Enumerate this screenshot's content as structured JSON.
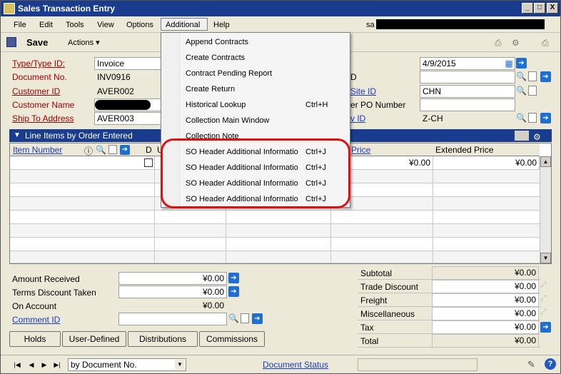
{
  "window": {
    "title": "Sales Transaction Entry",
    "controls": [
      "_",
      "□",
      "X"
    ]
  },
  "menu": {
    "items": [
      "File",
      "Edit",
      "Tools",
      "View",
      "Options",
      "Additional",
      "Help"
    ],
    "user_prefix": "sa"
  },
  "toolbar": {
    "save_label": "Save",
    "actions_label": "Actions"
  },
  "form": {
    "type_label": "Type/Type ID:",
    "type_value": "Invoice",
    "doc_no_label": "Document No.",
    "doc_no_value": "INV0916",
    "customer_id_label": "Customer ID",
    "customer_id_value": "AVER002",
    "customer_name_label": "Customer Name",
    "ship_to_label": "Ship To Address",
    "ship_to_value": "AVER003",
    "date_value": "4/9/2015",
    "d_partial": "D",
    "site_id_partial": "Site ID",
    "site_id_value": "CHN",
    "po_partial": "er PO Number",
    "via_partial": "v ID",
    "via_value": "Z-CH"
  },
  "grid": {
    "header": "Line Items by Order Entered",
    "col_item_number": "Item Number",
    "col_d": "D",
    "col_u": "U",
    "col_price_partial": "Price",
    "col_extended_price": "Extended Price",
    "row1_price": "¥0.00",
    "row1_extended": "¥0.00"
  },
  "left_totals": {
    "amount_received_label": "Amount Received",
    "amount_received_value": "¥0.00",
    "terms_discount_label": "Terms Discount Taken",
    "terms_discount_value": "¥0.00",
    "on_account_label": "On Account",
    "on_account_value": "¥0.00",
    "comment_id_label": "Comment ID"
  },
  "right_totals": {
    "subtotal_label": "Subtotal",
    "subtotal_value": "¥0.00",
    "trade_discount_label": "Trade Discount",
    "trade_discount_value": "¥0.00",
    "freight_label": "Freight",
    "freight_value": "¥0.00",
    "misc_label": "Miscellaneous",
    "misc_value": "¥0.00",
    "tax_label": "Tax",
    "tax_value": "¥0.00",
    "total_label": "Total",
    "total_value": "¥0.00"
  },
  "buttons": [
    "Holds",
    "User-Defined",
    "Distributions",
    "Commissions"
  ],
  "statusbar": {
    "sort_value": "by Document No.",
    "doc_status_link": "Document Status"
  },
  "dropdown": {
    "items": [
      {
        "label": "Append Contracts",
        "shortcut": ""
      },
      {
        "label": "Create Contracts",
        "shortcut": ""
      },
      {
        "label": "Contract Pending Report",
        "shortcut": ""
      },
      {
        "label": "Create Return",
        "shortcut": ""
      },
      {
        "label": "Historical Lookup",
        "shortcut": "Ctrl+H"
      },
      {
        "label": "Collection Main Window",
        "shortcut": ""
      },
      {
        "label": "Collection Note",
        "shortcut": ""
      },
      {
        "label": "SO Header Additional Informatio",
        "shortcut": "Ctrl+J"
      },
      {
        "label": "SO Header Additional Informatio",
        "shortcut": "Ctrl+J"
      },
      {
        "label": "SO Header Additional Informatio",
        "shortcut": "Ctrl+J"
      },
      {
        "label": "SO Header Additional Informatio",
        "shortcut": "Ctrl+J"
      }
    ]
  },
  "colors": {
    "title_bar": "#1a3c8e",
    "required_label": "#a00000",
    "link": "#1a3ccc",
    "highlight": "#e01010"
  }
}
